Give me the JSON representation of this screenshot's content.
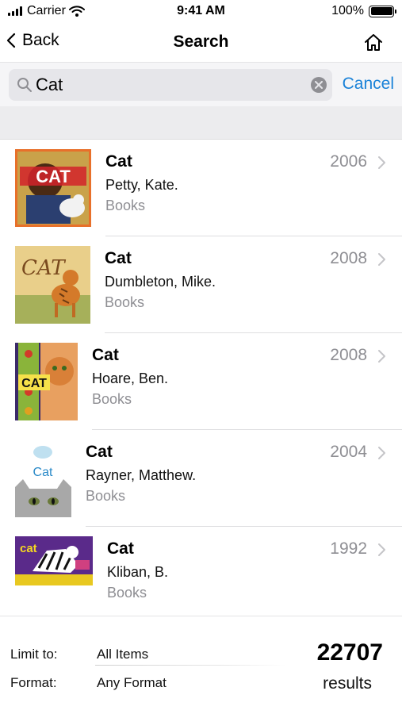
{
  "status_bar": {
    "carrier": "Carrier",
    "time": "9:41 AM",
    "battery": "100%",
    "battery_level": 1.0
  },
  "nav": {
    "back_label": "Back",
    "title": "Search",
    "home_icon": "home-icon"
  },
  "search": {
    "value": "Cat",
    "cancel_label": "Cancel",
    "icon": "search-icon",
    "clear_icon": "clear-icon"
  },
  "results": [
    {
      "title": "Cat",
      "author": "Petty, Kate.",
      "format": "Books",
      "year": "2006"
    },
    {
      "title": "Cat",
      "author": "Dumbleton, Mike.",
      "format": "Books",
      "year": "2008"
    },
    {
      "title": "Cat",
      "author": "Hoare, Ben.",
      "format": "Books",
      "year": "2008"
    },
    {
      "title": "Cat",
      "author": "Rayner, Matthew.",
      "format": "Books",
      "year": "2004"
    },
    {
      "title": "Cat",
      "author": "Kliban, B.",
      "format": "Books",
      "year": "1992"
    }
  ],
  "footer": {
    "limit_label": "Limit to:",
    "limit_value": "All Items",
    "format_label": "Format:",
    "format_value": "Any Format",
    "count": "22707",
    "count_label": "results"
  },
  "colors": {
    "accent": "#1a82d8",
    "secondary_text": "#8e8e93"
  }
}
